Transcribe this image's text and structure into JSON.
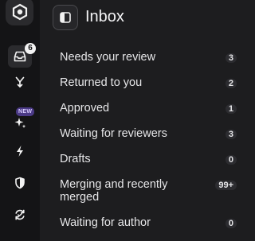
{
  "rail": {
    "logo_icon": "hexagon-logo-icon",
    "inbox_badge": "6",
    "new_badge": "NEW",
    "icons": [
      "inbox-icon",
      "merge-icon",
      "sparkles-icon",
      "bolt-icon",
      "shield-icon",
      "sync-icon"
    ]
  },
  "header": {
    "title": "Inbox",
    "toggle_icon": "sidebar-toggle-icon"
  },
  "sections": [
    {
      "label": "Needs your review",
      "count": "3"
    },
    {
      "label": "Returned to you",
      "count": "2"
    },
    {
      "label": "Approved",
      "count": "1"
    },
    {
      "label": "Waiting for reviewers",
      "count": "3"
    },
    {
      "label": "Drafts",
      "count": "0"
    },
    {
      "label": "Merging and recently merged",
      "count": "99+"
    },
    {
      "label": "Waiting for author",
      "count": "0"
    }
  ],
  "colors": {
    "background": "#1d1d1f",
    "rail": "#141416",
    "new_badge": "#4b3a86"
  }
}
